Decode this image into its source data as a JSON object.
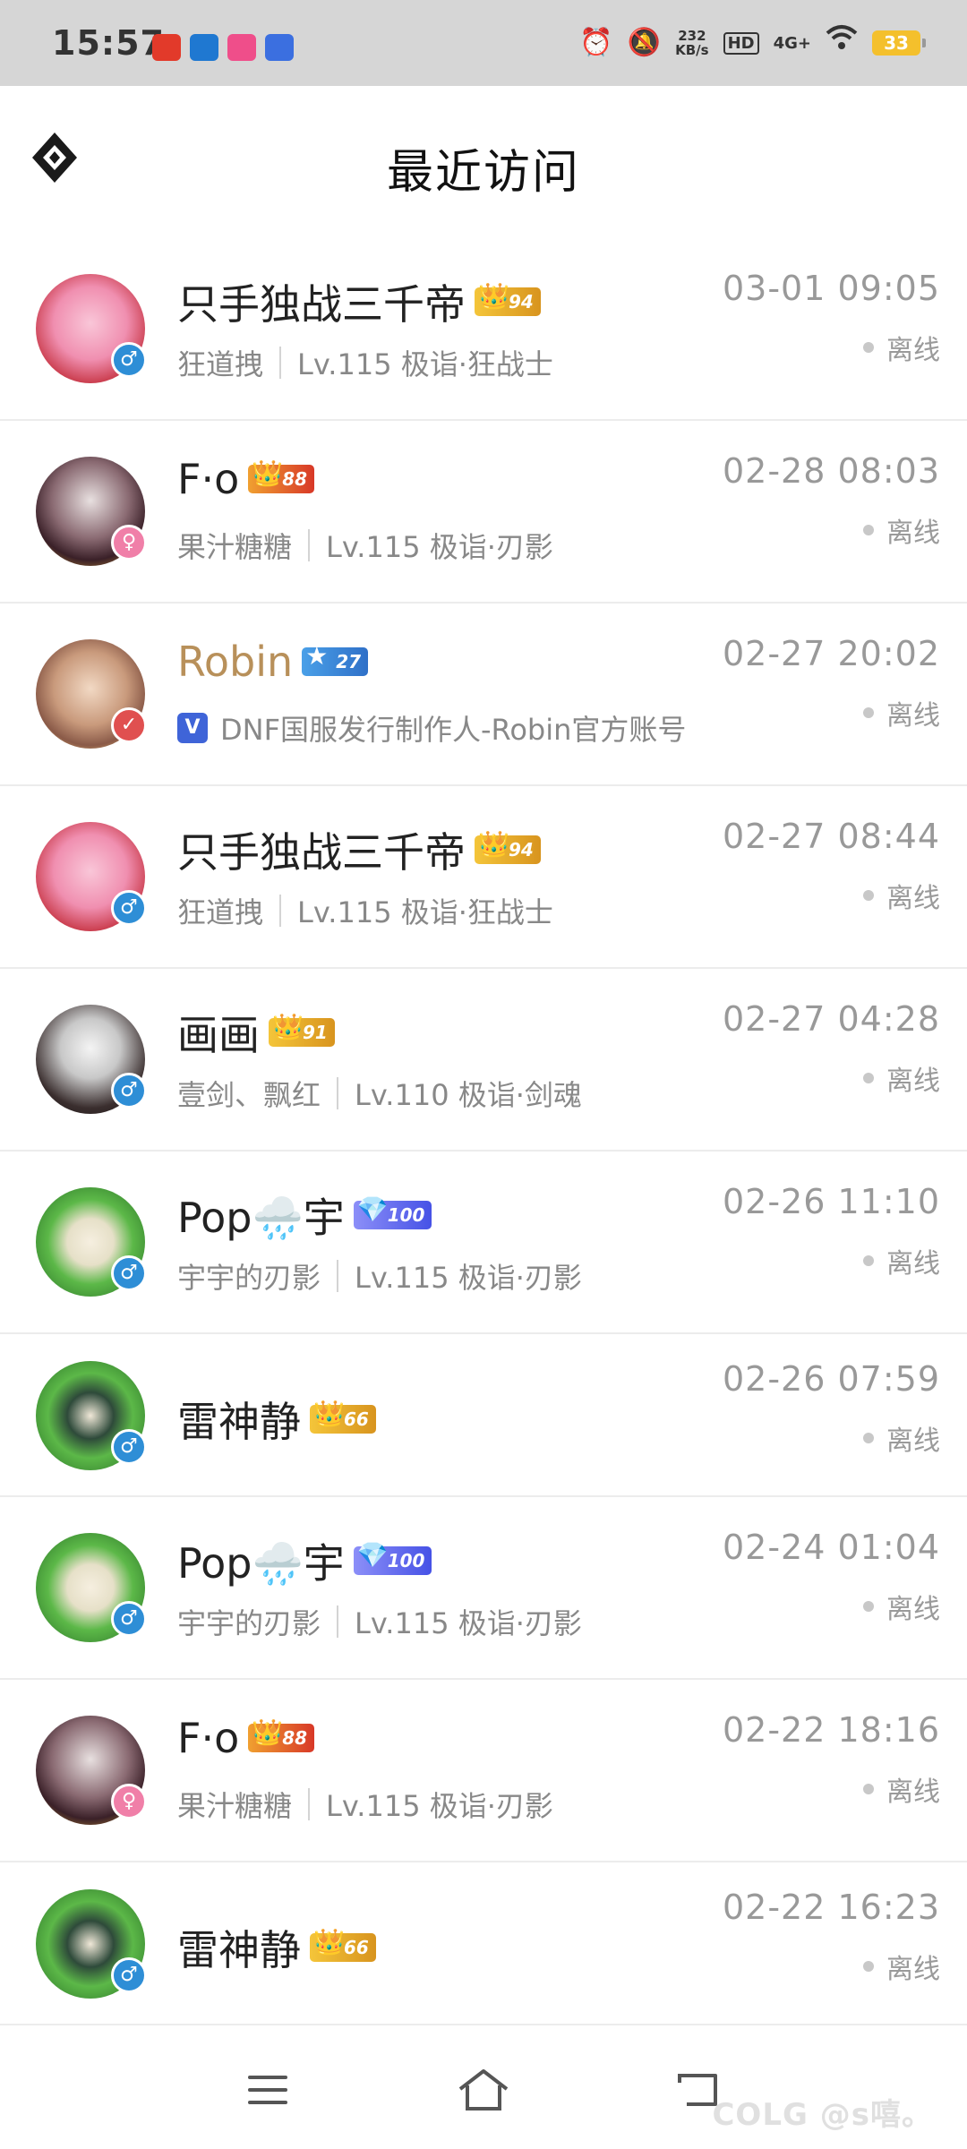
{
  "status_bar": {
    "time": "15:57",
    "net_speed_value": "232",
    "net_speed_unit": "KB/s",
    "hd": "HD",
    "network": "4G+",
    "battery": "33"
  },
  "header": {
    "title": "最近访问"
  },
  "visits": [
    {
      "name": "只手独战三千帝",
      "badge_level": "94",
      "badge_style": "gold",
      "sub_primary": "狂道拽",
      "sub_secondary": "Lv.115 极诣·狂战士",
      "time": "03-01 09:05",
      "status": "离线",
      "gender": "♂",
      "gender_type": "m"
    },
    {
      "name": "F·o",
      "badge_level": "88",
      "badge_style": "red",
      "sub_primary": "果汁糖糖",
      "sub_secondary": "Lv.115 极诣·刃影",
      "time": "02-28 08:03",
      "status": "离线",
      "gender": "♀",
      "gender_type": "f"
    },
    {
      "name": "Robin",
      "badge_level": "27",
      "badge_style": "blue",
      "sub_verified": "V",
      "sub_primary": "DNF国服发行制作人-Robin官方账号",
      "time": "02-27 20:02",
      "status": "离线",
      "official": true
    },
    {
      "name": "只手独战三千帝",
      "badge_level": "94",
      "badge_style": "gold",
      "sub_primary": "狂道拽",
      "sub_secondary": "Lv.115 极诣·狂战士",
      "time": "02-27 08:44",
      "status": "离线",
      "gender": "♂",
      "gender_type": "m"
    },
    {
      "name": "画画",
      "badge_level": "91",
      "badge_style": "gold",
      "sub_primary": "壹剑、飘红",
      "sub_secondary": "Lv.110 极诣·剑魂",
      "time": "02-27 04:28",
      "status": "离线",
      "gender": "♂",
      "gender_type": "m"
    },
    {
      "name": "Pop🌧️宇",
      "badge_level": "100",
      "badge_style": "diamond",
      "sub_primary": "宇宇的刃影",
      "sub_secondary": "Lv.115 极诣·刃影",
      "time": "02-26 11:10",
      "status": "离线",
      "gender": "♂",
      "gender_type": "m"
    },
    {
      "name": "雷神静",
      "badge_level": "66",
      "badge_style": "gold",
      "time": "02-26 07:59",
      "status": "离线",
      "gender": "♂",
      "gender_type": "m"
    },
    {
      "name": "Pop🌧️宇",
      "badge_level": "100",
      "badge_style": "diamond",
      "sub_primary": "宇宇的刃影",
      "sub_secondary": "Lv.115 极诣·刃影",
      "time": "02-24 01:04",
      "status": "离线",
      "gender": "♂",
      "gender_type": "m"
    },
    {
      "name": "F·o",
      "badge_level": "88",
      "badge_style": "red",
      "sub_primary": "果汁糖糖",
      "sub_secondary": "Lv.115 极诣·刃影",
      "time": "02-22 18:16",
      "status": "离线",
      "gender": "♀",
      "gender_type": "f"
    },
    {
      "name": "雷神静",
      "badge_level": "66",
      "badge_style": "gold",
      "time": "02-22 16:23",
      "status": "离线",
      "gender": "♂",
      "gender_type": "m"
    }
  ],
  "watermark": "COLG @s嘻。",
  "colors": {
    "official_name": "#b8905a",
    "male": "#2e8ed6",
    "female": "#f07fa8"
  }
}
